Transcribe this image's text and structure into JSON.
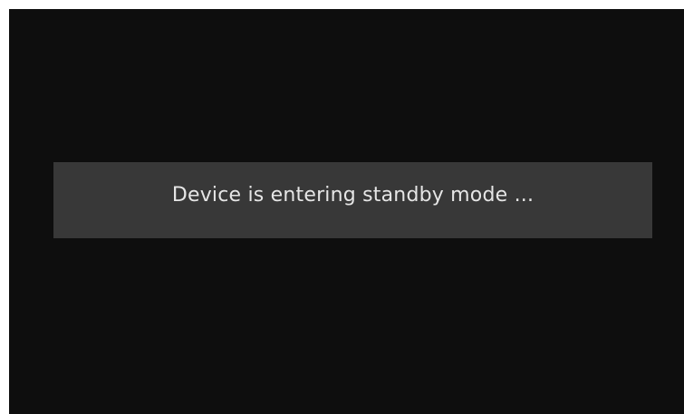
{
  "colors": {
    "screen_background": "#0e0e0e",
    "banner_background": "#383838",
    "message_text": "#e6e6e6"
  },
  "standby": {
    "message": "Device is entering standby mode ..."
  }
}
